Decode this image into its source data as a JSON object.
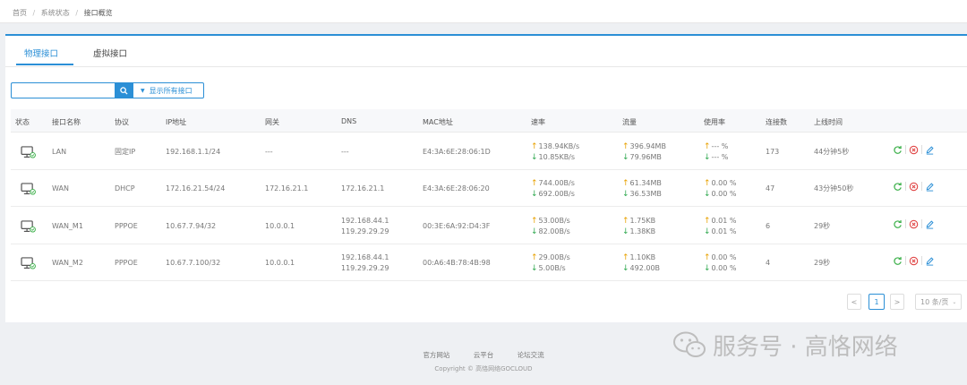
{
  "breadcrumb": {
    "home": "首页",
    "section": "系统状态",
    "current": "接口概览"
  },
  "tabs": [
    {
      "label": "物理接口",
      "active": true
    },
    {
      "label": "虚拟接口",
      "active": false
    }
  ],
  "search": {
    "value": "",
    "placeholder": "",
    "icon": "search-icon",
    "filter_label": "显示所有接口"
  },
  "columns": {
    "status": "状态",
    "name": "接口名称",
    "protocol": "协议",
    "ip": "IP地址",
    "gateway": "网关",
    "dns": "DNS",
    "mac": "MAC地址",
    "rate": "速率",
    "traffic": "流量",
    "usage": "使用率",
    "connections": "连接数",
    "online": "上线时间"
  },
  "rows": [
    {
      "name": "LAN",
      "protocol": "固定IP",
      "ip": "192.168.1.1/24",
      "gateway": "---",
      "dns1": "---",
      "dns2": "",
      "mac": "E4:3A:6E:28:06:1D",
      "rate_up": "138.94KB/s",
      "rate_down": "10.85KB/s",
      "traffic_up": "396.94MB",
      "traffic_down": "79.96MB",
      "usage_up": "--- %",
      "usage_down": "--- %",
      "connections": "173",
      "online": "44分钟5秒"
    },
    {
      "name": "WAN",
      "protocol": "DHCP",
      "ip": "172.16.21.54/24",
      "gateway": "172.16.21.1",
      "dns1": "172.16.21.1",
      "dns2": "",
      "mac": "E4:3A:6E:28:06:20",
      "rate_up": "744.00B/s",
      "rate_down": "692.00B/s",
      "traffic_up": "61.34MB",
      "traffic_down": "36.53MB",
      "usage_up": "0.00 %",
      "usage_down": "0.00 %",
      "connections": "47",
      "online": "43分钟50秒"
    },
    {
      "name": "WAN_M1",
      "protocol": "PPPOE",
      "ip": "10.67.7.94/32",
      "gateway": "10.0.0.1",
      "dns1": "192.168.44.1",
      "dns2": "119.29.29.29",
      "mac": "00:3E:6A:92:D4:3F",
      "rate_up": "53.00B/s",
      "rate_down": "82.00B/s",
      "traffic_up": "1.75KB",
      "traffic_down": "1.38KB",
      "usage_up": "0.01 %",
      "usage_down": "0.01 %",
      "connections": "6",
      "online": "29秒"
    },
    {
      "name": "WAN_M2",
      "protocol": "PPPOE",
      "ip": "10.67.7.100/32",
      "gateway": "10.0.0.1",
      "dns1": "192.168.44.1",
      "dns2": "119.29.29.29",
      "mac": "00:A6:4B:78:4B:98",
      "rate_up": "29.00B/s",
      "rate_down": "5.00B/s",
      "traffic_up": "1.10KB",
      "traffic_down": "492.00B",
      "usage_up": "0.00 %",
      "usage_down": "0.00 %",
      "connections": "4",
      "online": "29秒"
    }
  ],
  "pagination": {
    "prev": "<",
    "current": "1",
    "next": ">",
    "page_size": "10 条/页"
  },
  "footer": {
    "link1": "官方网站",
    "link2": "云平台",
    "link3": "论坛交流",
    "copyright": "Copyright © 高恪网络GOCLOUD"
  },
  "watermark": {
    "text": "服务号 · 高恪网络"
  },
  "colors": {
    "accent": "#2b8fd6",
    "up_arrow": "#e8a100",
    "down_arrow": "#2fa84f",
    "refresh": "#3cb04a",
    "stop": "#e04545"
  }
}
